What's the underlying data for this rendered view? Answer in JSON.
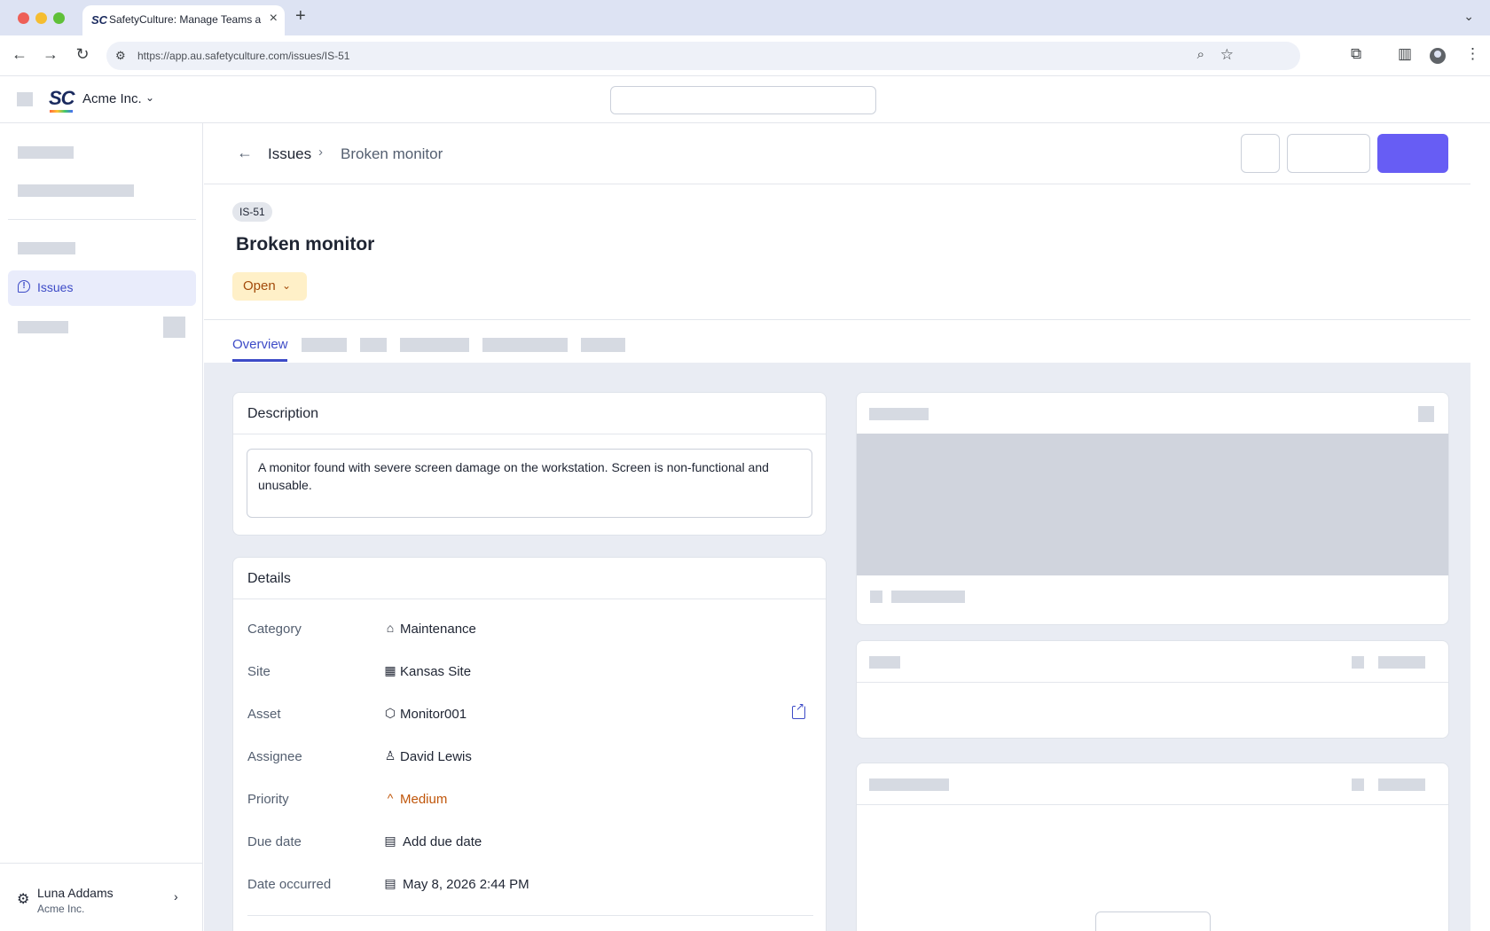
{
  "browser": {
    "tab_title": "SafetyCulture: Manage Teams and...",
    "tab_favicon": "SC",
    "url": "https://app.au.safetyculture.com/issues/IS-51",
    "icons": [
      "back-icon",
      "forward-icon",
      "reload-icon",
      "site-info-icon",
      "zoom-icon",
      "bookmark-star-icon",
      "extensions-icon",
      "side-panel-icon",
      "profile-icon",
      "menu-icon"
    ]
  },
  "app": {
    "logo": "SC",
    "org_name": "Acme Inc."
  },
  "sidebar": {
    "active_item": "Issues",
    "user": {
      "name": "Luna Addams",
      "org": "Acme Inc."
    }
  },
  "breadcrumb": {
    "root": "Issues",
    "current": "Broken monitor"
  },
  "issue": {
    "id": "IS-51",
    "title": "Broken monitor",
    "status": "Open"
  },
  "tabs": {
    "active": "Overview"
  },
  "description": {
    "heading": "Description",
    "text": "A monitor found with severe screen damage on the workstation. Screen is non-functional and unusable."
  },
  "details": {
    "heading": "Details",
    "rows": [
      {
        "label": "Category",
        "value": "Maintenance",
        "icon": "tag-icon"
      },
      {
        "label": "Site",
        "value": "Kansas Site",
        "icon": "building-icon"
      },
      {
        "label": "Asset",
        "value": "Monitor001",
        "icon": "cube-icon"
      },
      {
        "label": "Assignee",
        "value": "David Lewis",
        "icon": "person-icon"
      },
      {
        "label": "Priority",
        "value": "Medium",
        "icon": "chevron-up-icon"
      },
      {
        "label": "Due date",
        "value": "Add due date",
        "icon": "calendar-icon"
      },
      {
        "label": "Date occurred",
        "value": "May 8, 2026 2:44 PM",
        "icon": "calendar-icon"
      }
    ]
  },
  "colors": {
    "accent": "#3d4bc7",
    "primary_button": "#675df4",
    "status_bg": "#fff0c8",
    "status_text": "#a34a0a",
    "priority_medium": "#c0560a",
    "content_bg": "#e9ecf3",
    "skeleton": "#d6dae2"
  }
}
